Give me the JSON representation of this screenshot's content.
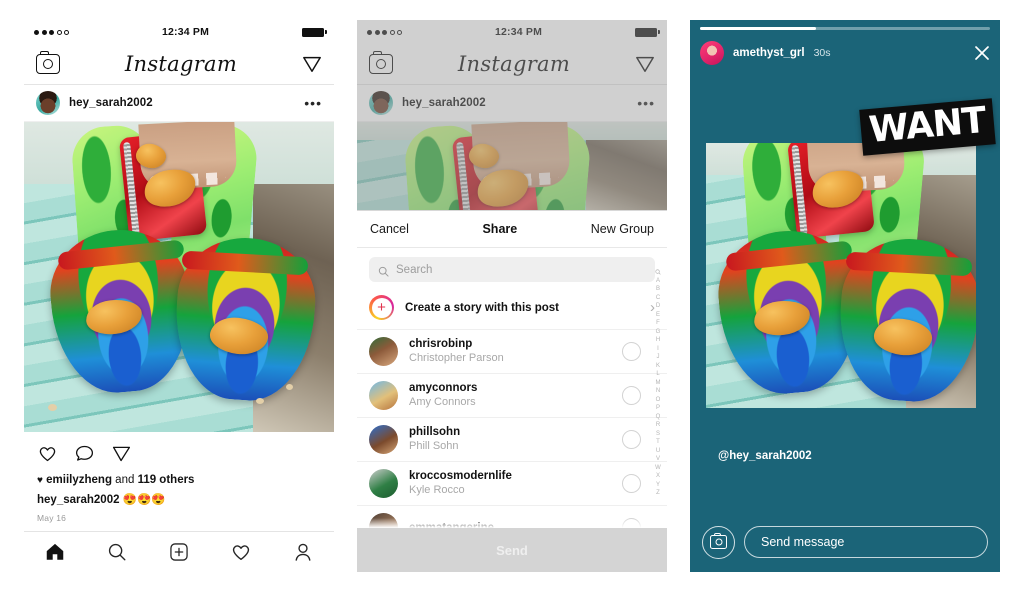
{
  "panels": {
    "feed": {
      "status_bar": {
        "time": "12:34 PM",
        "signal_icon": "signal-dots-icon",
        "battery_icon": "battery-full-icon"
      },
      "app_bar": {
        "camera_icon": "camera-icon",
        "logo": "Instagram",
        "direct_icon": "direct-share-icon"
      },
      "post": {
        "avatar": "user-avatar",
        "username": "hey_sarah2002",
        "more_icon": "more-options-icon",
        "photo_alt": "tie-dye crocs with chicken nugget charms on a mint bench",
        "actions": {
          "like": "heart-icon",
          "comment": "comment-icon",
          "share": "share-icon"
        },
        "likes_prefix": "♥",
        "likes_user": "emiilyzheng",
        "likes_middle": "and",
        "likes_rest": "119 others",
        "caption_user": "hey_sarah2002",
        "caption_text": "😍😍😍",
        "date": "May 16"
      },
      "tab_bar": {
        "items": [
          {
            "name": "home-tab",
            "icon": "home-icon",
            "active": true
          },
          {
            "name": "search-tab",
            "icon": "search-icon",
            "active": false
          },
          {
            "name": "new-post-tab",
            "icon": "plus-box-icon",
            "active": false
          },
          {
            "name": "activity-tab",
            "icon": "heart-icon",
            "active": false
          },
          {
            "name": "profile-tab",
            "icon": "person-icon",
            "active": false
          }
        ]
      }
    },
    "share": {
      "status_bar": {
        "time": "12:34 PM"
      },
      "app_bar": {
        "logo": "Instagram"
      },
      "post": {
        "username": "hey_sarah2002"
      },
      "sheet": {
        "cancel_label": "Cancel",
        "title": "Share",
        "new_group_label": "New Group",
        "search_placeholder": "Search",
        "search_icon": "search-icon",
        "create_story_label": "Create a story with this post",
        "create_story_icon": "story-plus-icon",
        "chevron_icon": "chevron-right-icon",
        "contacts": [
          {
            "username": "chrisrobinp",
            "fullname": "Christopher Parson",
            "selected": false
          },
          {
            "username": "amyconnors",
            "fullname": "Amy Connors",
            "selected": false
          },
          {
            "username": "phillsohn",
            "fullname": "Phill Sohn",
            "selected": false
          },
          {
            "username": "kroccosmodernlife",
            "fullname": "Kyle Rocco",
            "selected": false
          },
          {
            "username": "emmatangerine",
            "fullname": "",
            "selected": false
          }
        ],
        "alphabet_index": [
          "A",
          "B",
          "C",
          "D",
          "E",
          "F",
          "G",
          "H",
          "I",
          "J",
          "K",
          "L",
          "M",
          "N",
          "O",
          "P",
          "Q",
          "R",
          "S",
          "T",
          "U",
          "V",
          "W",
          "X",
          "Y",
          "Z"
        ],
        "send_label": "Send",
        "send_enabled": false
      }
    },
    "story": {
      "background_color": "#1b6478",
      "progress_percent": 40,
      "avatar": "story-author-avatar",
      "username": "amethyst_grl",
      "timestamp": "30s",
      "close_icon": "close-icon",
      "sticker_text": "WANT",
      "handle_mention": "@hey_sarah2002",
      "camera_icon": "camera-icon",
      "message_placeholder": "Send message"
    }
  }
}
